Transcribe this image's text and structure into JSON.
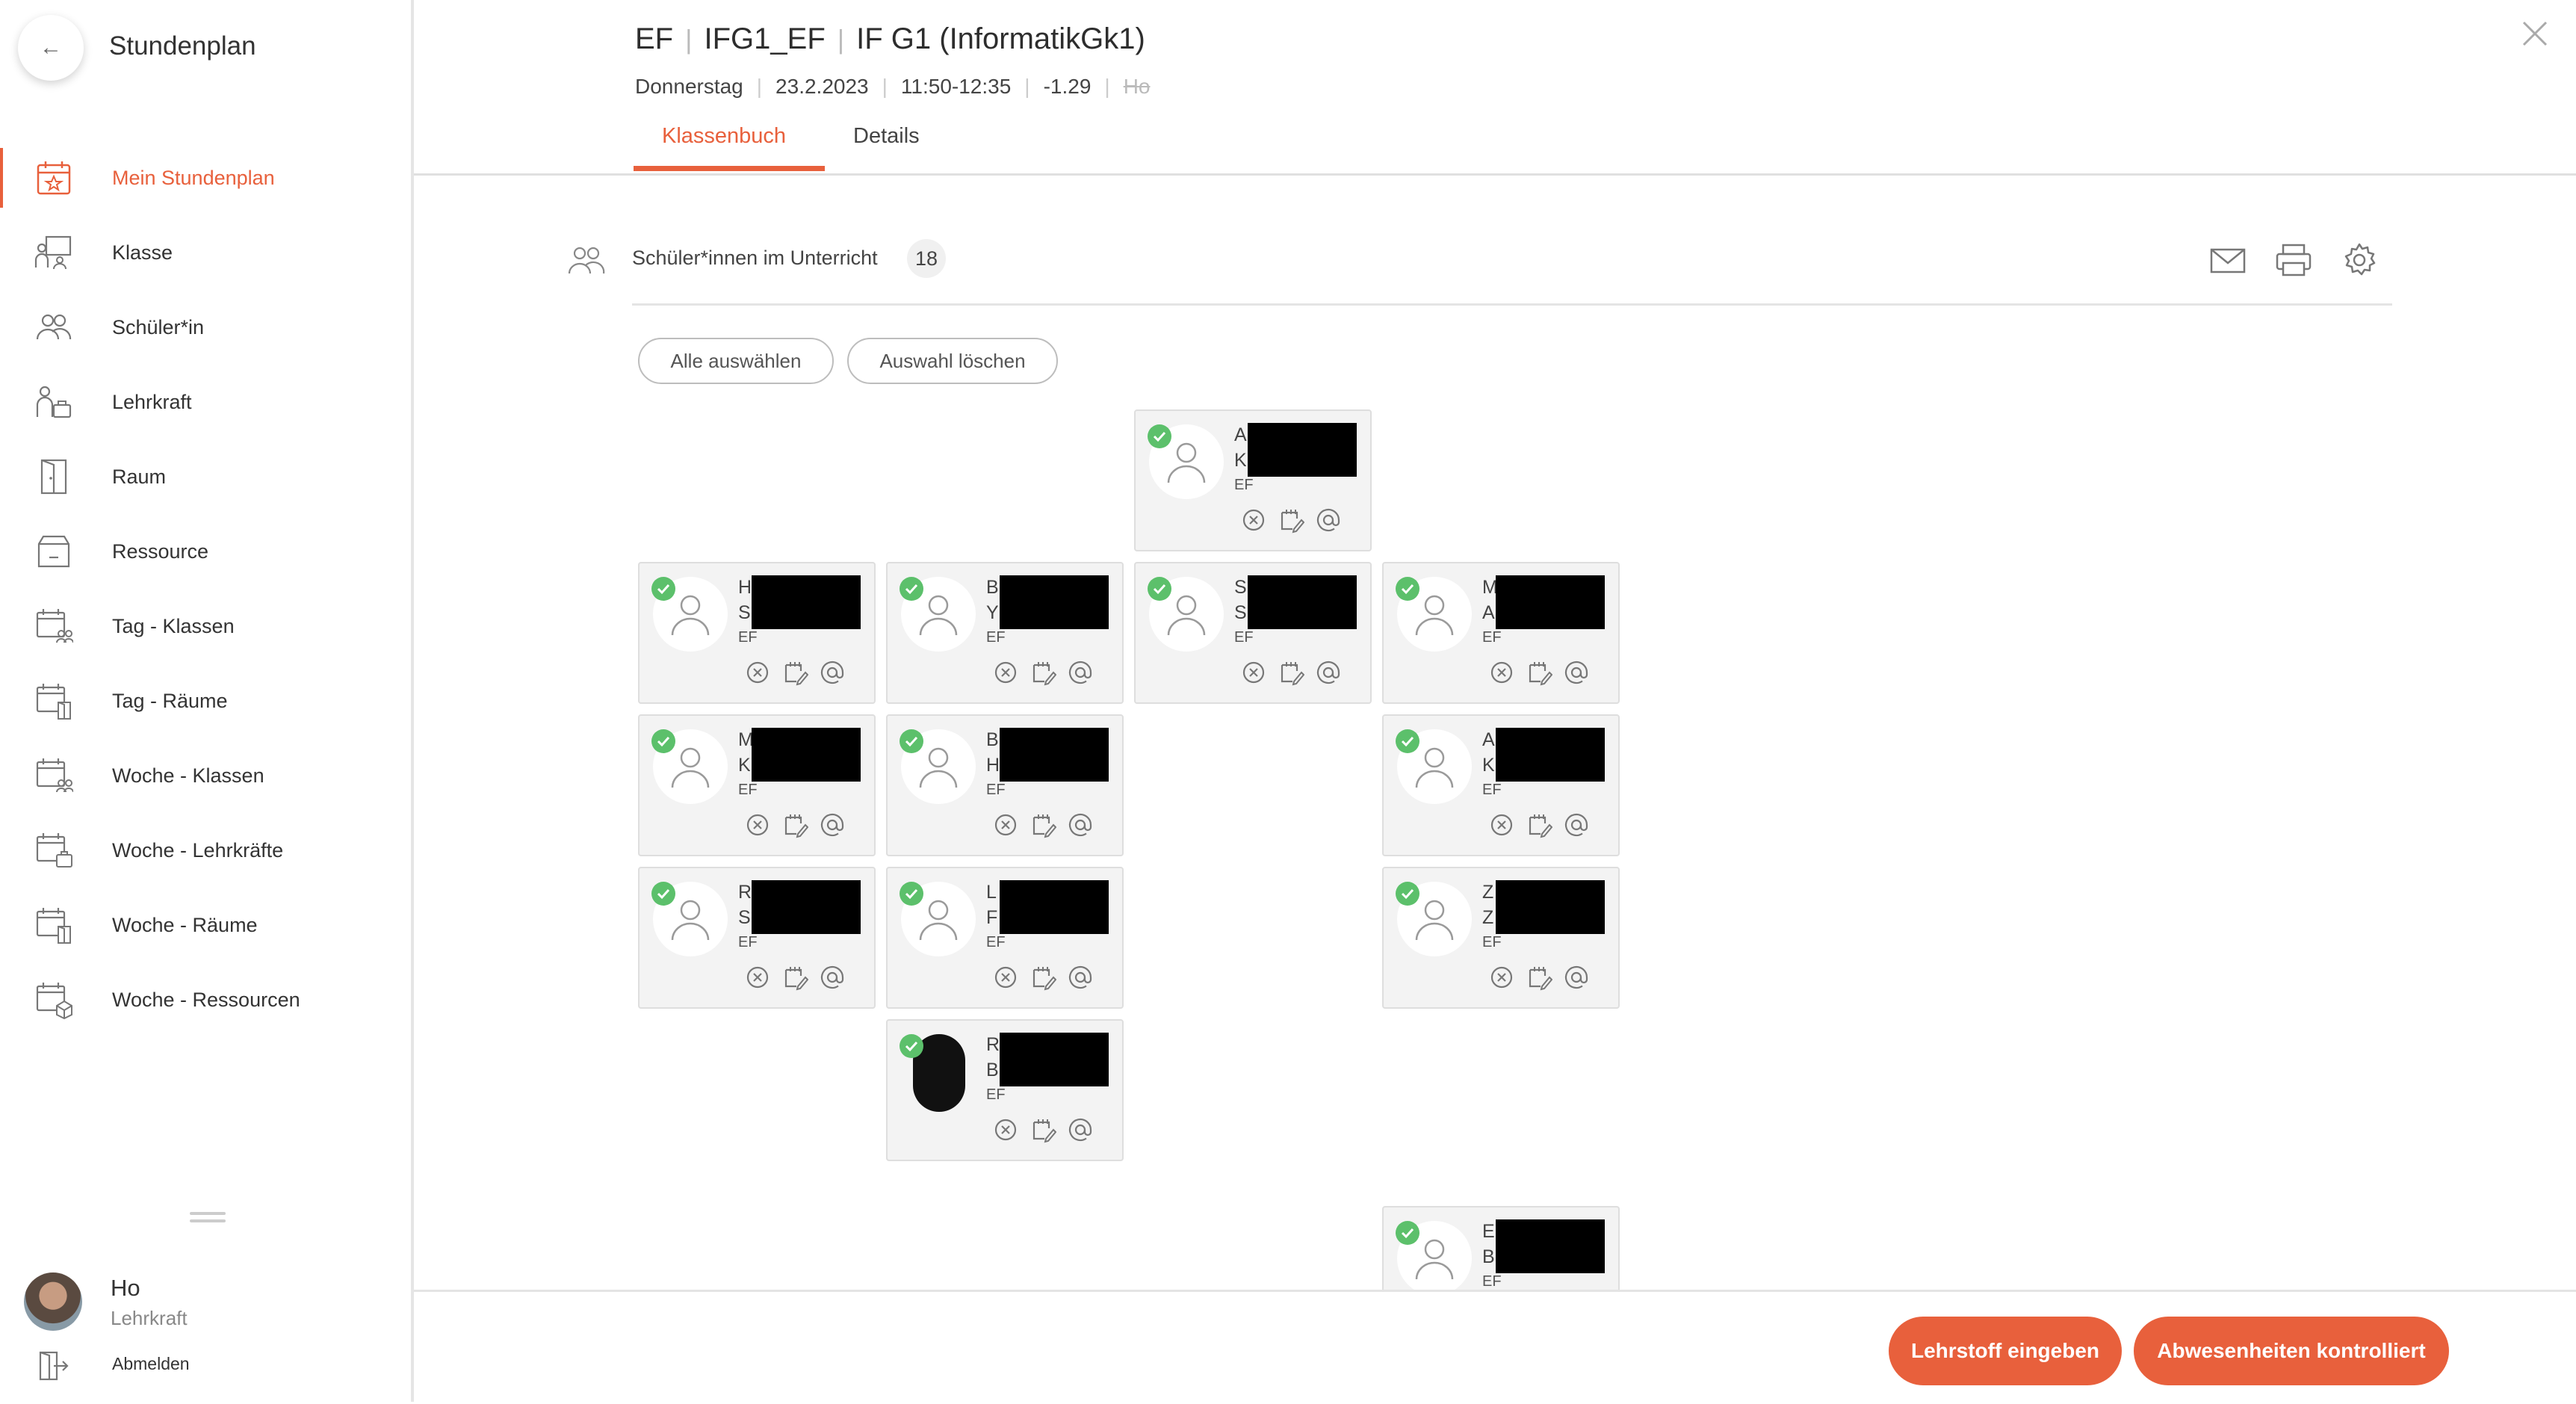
{
  "app": {
    "title": "Stundenplan"
  },
  "nav": {
    "items": [
      {
        "label": "Mein Stundenplan",
        "icon": "calendar-star-icon",
        "active": true
      },
      {
        "label": "Klasse",
        "icon": "class-board-icon"
      },
      {
        "label": "Schüler*in",
        "icon": "students-icon"
      },
      {
        "label": "Lehrkraft",
        "icon": "teacher-icon"
      },
      {
        "label": "Raum",
        "icon": "door-icon"
      },
      {
        "label": "Ressource",
        "icon": "box-icon"
      },
      {
        "label": "Tag - Klassen",
        "icon": "calendar-group-icon"
      },
      {
        "label": "Tag - Räume",
        "icon": "calendar-room-icon"
      },
      {
        "label": "Woche - Klassen",
        "icon": "calendar-group-icon"
      },
      {
        "label": "Woche - Lehrkräfte",
        "icon": "calendar-teacher-icon"
      },
      {
        "label": "Woche - Räume",
        "icon": "calendar-room-icon"
      },
      {
        "label": "Woche - Ressourcen",
        "icon": "calendar-box-icon"
      }
    ]
  },
  "user": {
    "name": "Ho",
    "role": "Lehrkraft",
    "logout_label": "Abmelden"
  },
  "header": {
    "title_parts": [
      "EF",
      "IFG1_EF",
      "IF G1 (InformatikGk1)"
    ],
    "weekday": "Donnerstag",
    "date": "23.2.2023",
    "time": "11:50-12:35",
    "room": "-1.29",
    "teacher": "Ho",
    "tabs": [
      {
        "label": "Klassenbuch",
        "active": true
      },
      {
        "label": "Details"
      }
    ]
  },
  "section": {
    "label": "Schüler*innen im Unterricht",
    "count": "18"
  },
  "buttons": {
    "select_all": "Alle auswählen",
    "clear_selection": "Auswahl löschen"
  },
  "students": [
    {
      "n1": "A",
      "n2": "K",
      "cls": "EF"
    },
    {
      "n1": "H",
      "n2": "S",
      "cls": "EF"
    },
    {
      "n1": "B",
      "n2": "Y",
      "cls": "EF"
    },
    {
      "n1": "S",
      "n2": "S",
      "cls": "EF"
    },
    {
      "n1": "M",
      "n2": "A",
      "cls": "EF"
    },
    {
      "n1": "M",
      "n2": "K",
      "cls": "EF"
    },
    {
      "n1": "B",
      "n2": "H",
      "cls": "EF"
    },
    {
      "n1": "A",
      "n2": "K",
      "cls": "EF"
    },
    {
      "n1": "R",
      "n2": "S",
      "cls": "EF"
    },
    {
      "n1": "L",
      "n2": "F",
      "cls": "EF"
    },
    {
      "n1": "Z",
      "n2": "Z",
      "cls": "EF"
    },
    {
      "n1": "R",
      "n2": "B",
      "cls": "EF"
    },
    {
      "n1": "E",
      "n2": "B",
      "cls": "EF"
    }
  ],
  "footer": {
    "lehrstoff_label": "Lehrstoff eingeben",
    "abwesenheiten_label": "Abwesenheiten kontrolliert"
  },
  "colors": {
    "accent": "#e8603c",
    "check": "#5cc06b"
  }
}
